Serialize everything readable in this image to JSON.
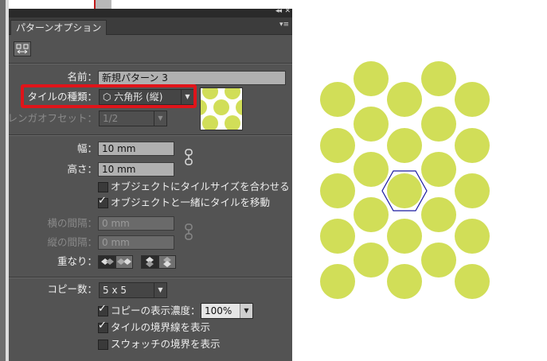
{
  "panel": {
    "tab_label": "パターンオプション",
    "collapse_glyph": "◂◂",
    "close_glyph": "✕",
    "menu_glyph": "▾≡",
    "name_label": "名前：",
    "name_value": "新規パターン 3",
    "tile_type_label": "タイルの種類：",
    "tile_type_value": "⬡ 六角形 (縦)",
    "brick_offset_label": "レンガオフセット：",
    "brick_offset_value": "1/2",
    "width_label": "幅：",
    "width_value": "10 mm",
    "height_label": "高さ：",
    "height_value": "10 mm",
    "size_to_art_label": "オブジェクトにタイルサイズを合わせる",
    "size_to_art_checked": false,
    "move_with_art_label": "オブジェクトと一緒にタイルを移動",
    "move_with_art_checked": true,
    "h_spacing_label": "横の間隔：",
    "h_spacing_value": "0 mm",
    "v_spacing_label": "縦の間隔：",
    "v_spacing_value": "0 mm",
    "overlap_label": "重なり：",
    "copies_label": "コピー数：",
    "copies_value": "5 x 5",
    "dim_copies_label": "コピーの表示濃度：",
    "dim_copies_checked": true,
    "dim_copies_value": "100%",
    "show_tile_edge_label": "タイルの境界線を表示",
    "show_tile_edge_checked": true,
    "show_swatch_bounds_label": "スウォッチの境界を表示",
    "show_swatch_bounds_checked": false,
    "check_glyph": "✓",
    "arrow_glyph": "▼"
  },
  "colors": {
    "panel_bg": "#535353",
    "dot_fill": "#d1de58",
    "tile_outline": "#1a1aa0",
    "highlight_box": "#e0141a"
  },
  "canvas": {
    "copies": "5 x 5",
    "dot_count": 28
  }
}
